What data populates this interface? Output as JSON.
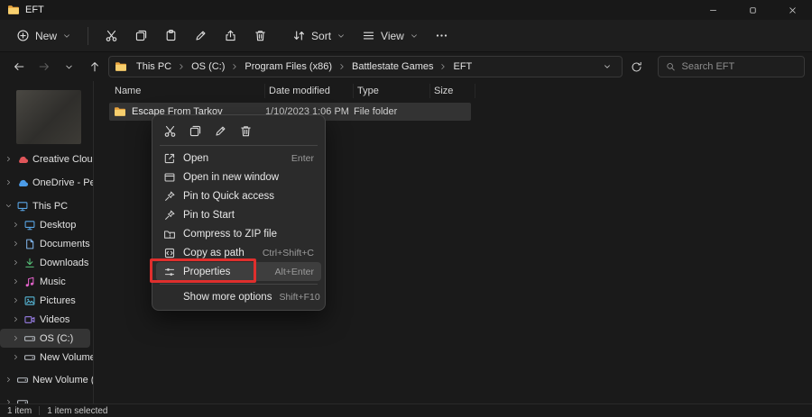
{
  "window": {
    "title": "EFT"
  },
  "toolbar": {
    "new_label": "New",
    "sort_label": "Sort",
    "view_label": "View",
    "action_icons": [
      "cut",
      "copy",
      "paste",
      "rename",
      "share",
      "delete"
    ],
    "more_icon": "see-more-dots"
  },
  "navigation": {
    "buttons": [
      "back",
      "forward",
      "recent-locations",
      "up",
      "refresh"
    ],
    "breadcrumb": {
      "crumbs": [
        "This PC",
        "OS (C:)",
        "Program Files (x86)",
        "Battlestate Games",
        "EFT"
      ]
    }
  },
  "search": {
    "placeholder": "Search EFT"
  },
  "sidebar": {
    "items": [
      {
        "label": "Creative Cloud F",
        "icon": "cloud",
        "chevron": "right"
      },
      {
        "label": "OneDrive - Perso",
        "icon": "cloud",
        "chevron": "right"
      },
      {
        "label": "This PC",
        "icon": "monitor",
        "chevron": "down"
      },
      {
        "label": "Desktop",
        "icon": "monitor",
        "chevron": "right"
      },
      {
        "label": "Documents",
        "icon": "document",
        "chevron": "right"
      },
      {
        "label": "Downloads",
        "icon": "download",
        "chevron": "right"
      },
      {
        "label": "Music",
        "icon": "music-note",
        "chevron": "right"
      },
      {
        "label": "Pictures",
        "icon": "picture",
        "chevron": "right"
      },
      {
        "label": "Videos",
        "icon": "video",
        "chevron": "right"
      },
      {
        "label": "OS (C:)",
        "icon": "drive",
        "chevron": "right",
        "selected": true
      },
      {
        "label": "New Volume (D",
        "icon": "drive",
        "chevron": "right"
      },
      {
        "label": "New Volume (D:)",
        "icon": "drive",
        "chevron": "right"
      },
      {
        "label": "",
        "icon": "drive",
        "chevron": "right"
      }
    ]
  },
  "file_list": {
    "columns": [
      "Name",
      "Date modified",
      "Type",
      "Size"
    ],
    "rows": [
      {
        "name": "Escape From Tarkov",
        "date_modified": "1/10/2023 1:06 PM",
        "type": "File folder",
        "size": ""
      }
    ]
  },
  "context_menu": {
    "quick_actions": [
      "cut",
      "copy",
      "rename",
      "delete"
    ],
    "items": [
      {
        "label": "Open",
        "shortcut": "Enter",
        "icon": "open"
      },
      {
        "label": "Open in new window",
        "shortcut": "",
        "icon": "new-window"
      },
      {
        "label": "Pin to Quick access",
        "shortcut": "",
        "icon": "pin"
      },
      {
        "label": "Pin to Start",
        "shortcut": "",
        "icon": "pin"
      },
      {
        "label": "Compress to ZIP file",
        "shortcut": "",
        "icon": "zip-folder"
      },
      {
        "label": "Copy as path",
        "shortcut": "Ctrl+Shift+C",
        "icon": "copy-path"
      },
      {
        "label": "Properties",
        "shortcut": "Alt+Enter",
        "icon": "properties",
        "highlighted": true,
        "annotated": true
      },
      {
        "label": "Show more options",
        "shortcut": "Shift+F10",
        "icon": ""
      }
    ]
  },
  "status_bar": {
    "items_count": "1 item",
    "selection": "1 item selected"
  },
  "colors": {
    "annotation_red": "#df2f2d",
    "selection_bg": "#333333",
    "folder_yellow": "#f7cf6e"
  }
}
